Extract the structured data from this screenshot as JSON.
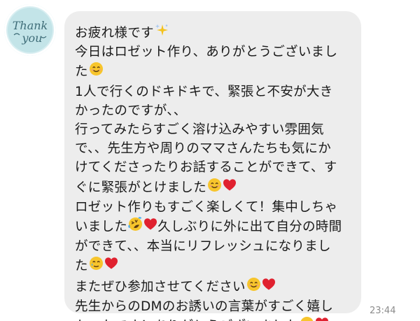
{
  "chat": {
    "avatar": {
      "icon": "thank-you-sticker-icon",
      "text_line1": "Thank",
      "text_line2": "you"
    },
    "message_lines": [
      {
        "text": "お疲れ様です",
        "emoji": "sparkles-icon"
      },
      {
        "text": "今日はロゼット作り、ありがとうございまし"
      },
      {
        "text": "た",
        "emoji": "smiling-face-icon"
      },
      {
        "text": "1人で行くのドキドキで、緊張と不安が大き"
      },
      {
        "text": "かったのですが、、"
      },
      {
        "text": "行ってみたらすごく溶け込みやすい雰囲気"
      },
      {
        "text": "で、、先生方や周りのママさんたちも気にか"
      },
      {
        "text": "けてくださったりお話することができて、す"
      },
      {
        "text": "ぐに緊張がとけました",
        "emoji": "smiling-face-icon",
        "emoji2": "heart-icon"
      },
      {
        "text": "ロゼット作りもすごく楽しくて！集中しちゃ"
      },
      {
        "text": "いました",
        "emoji": "rolling-laughing-icon",
        "emoji2": "heart-icon",
        "tail": "久しぶりに外に出て自分の時間"
      },
      {
        "text": "ができて、、本当にリフレッシュになりまし"
      },
      {
        "text": "た",
        "emoji": "happy-tear-icon",
        "emoji2": "heart-icon"
      },
      {
        "text": "またぜひ参加させてください",
        "emoji": "smiling-face-icon",
        "emoji2": "heart-icon"
      },
      {
        "text": "先生からのDMのお誘いの言葉がすごく嬉し"
      },
      {
        "text": "かったです！ありがとうございました",
        "emoji": "smiling-face-icon",
        "emoji2": "heart-icon"
      }
    ],
    "timestamp": "23:44"
  },
  "colors": {
    "bubble": "#ededed",
    "avatar": "#c3e4e8",
    "heart": "#e0212f",
    "smiley": "#f7c52c",
    "timestamp": "#8c8c8c"
  }
}
